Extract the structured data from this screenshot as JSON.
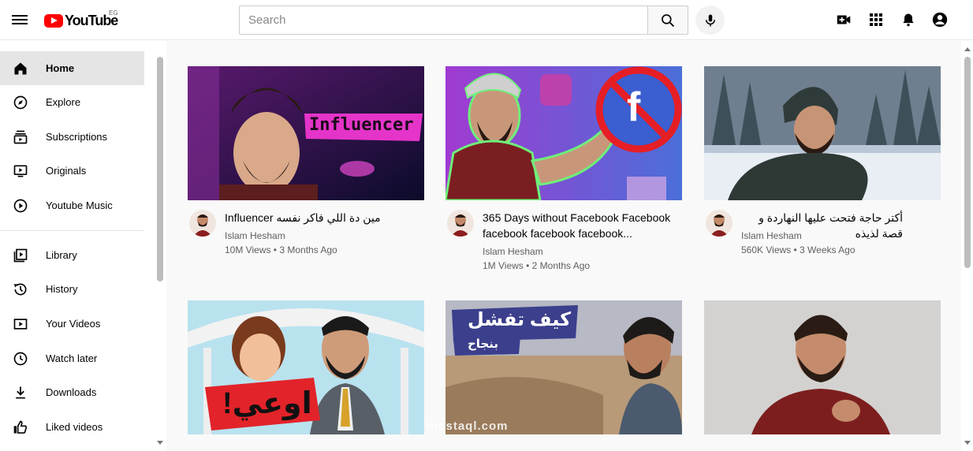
{
  "header": {
    "logo_text": "YouTube",
    "country_code": "EG",
    "search_placeholder": "Search"
  },
  "sidebar": {
    "items": [
      {
        "label": "Home",
        "icon": "home-icon",
        "active": true
      },
      {
        "label": "Explore",
        "icon": "compass-icon"
      },
      {
        "label": "Subscriptions",
        "icon": "subscriptions-icon"
      },
      {
        "label": "Originals",
        "icon": "originals-icon"
      },
      {
        "label": "Youtube Music",
        "icon": "music-icon"
      },
      {
        "label": "Library",
        "icon": "library-icon"
      },
      {
        "label": "History",
        "icon": "history-icon"
      },
      {
        "label": "Your Videos",
        "icon": "your-videos-icon"
      },
      {
        "label": "Watch later",
        "icon": "clock-icon"
      },
      {
        "label": "Downloads",
        "icon": "download-icon"
      },
      {
        "label": "Liked videos",
        "icon": "thumbs-up-icon"
      }
    ]
  },
  "videos": [
    {
      "title": "Influencer مين دة اللي فاكر نفسه",
      "channel": "Islam Hesham",
      "stats": "10M Views • 3 Months Ago",
      "thumb_text": "Influencer"
    },
    {
      "title": "365 Days without Facebook Facebook facebook facebook facebook...",
      "channel": "Islam Hesham",
      "stats": "1M Views • 2 Months Ago",
      "thumb_text": "f"
    },
    {
      "title": "أكتر حاجة فتحت عليها النهاردة و قصة لذيذه",
      "channel": "Islam Hesham",
      "stats": "560K Views • 3 Weeks Ago",
      "thumb_text": ""
    },
    {
      "title": "",
      "channel": "",
      "stats": "",
      "thumb_text": "اوعي!"
    },
    {
      "title": "",
      "channel": "",
      "stats": "",
      "thumb_text": "كيف تفشل",
      "thumb_subtext": "بنجاح"
    },
    {
      "title": "",
      "channel": "",
      "stats": "",
      "thumb_text": ""
    }
  ],
  "watermark": "mostaql.com",
  "colors": {
    "brand_red": "#ff0000",
    "active_bg": "#e5e5e5",
    "main_bg": "#f9f9f9",
    "secondary_text": "#606060"
  }
}
